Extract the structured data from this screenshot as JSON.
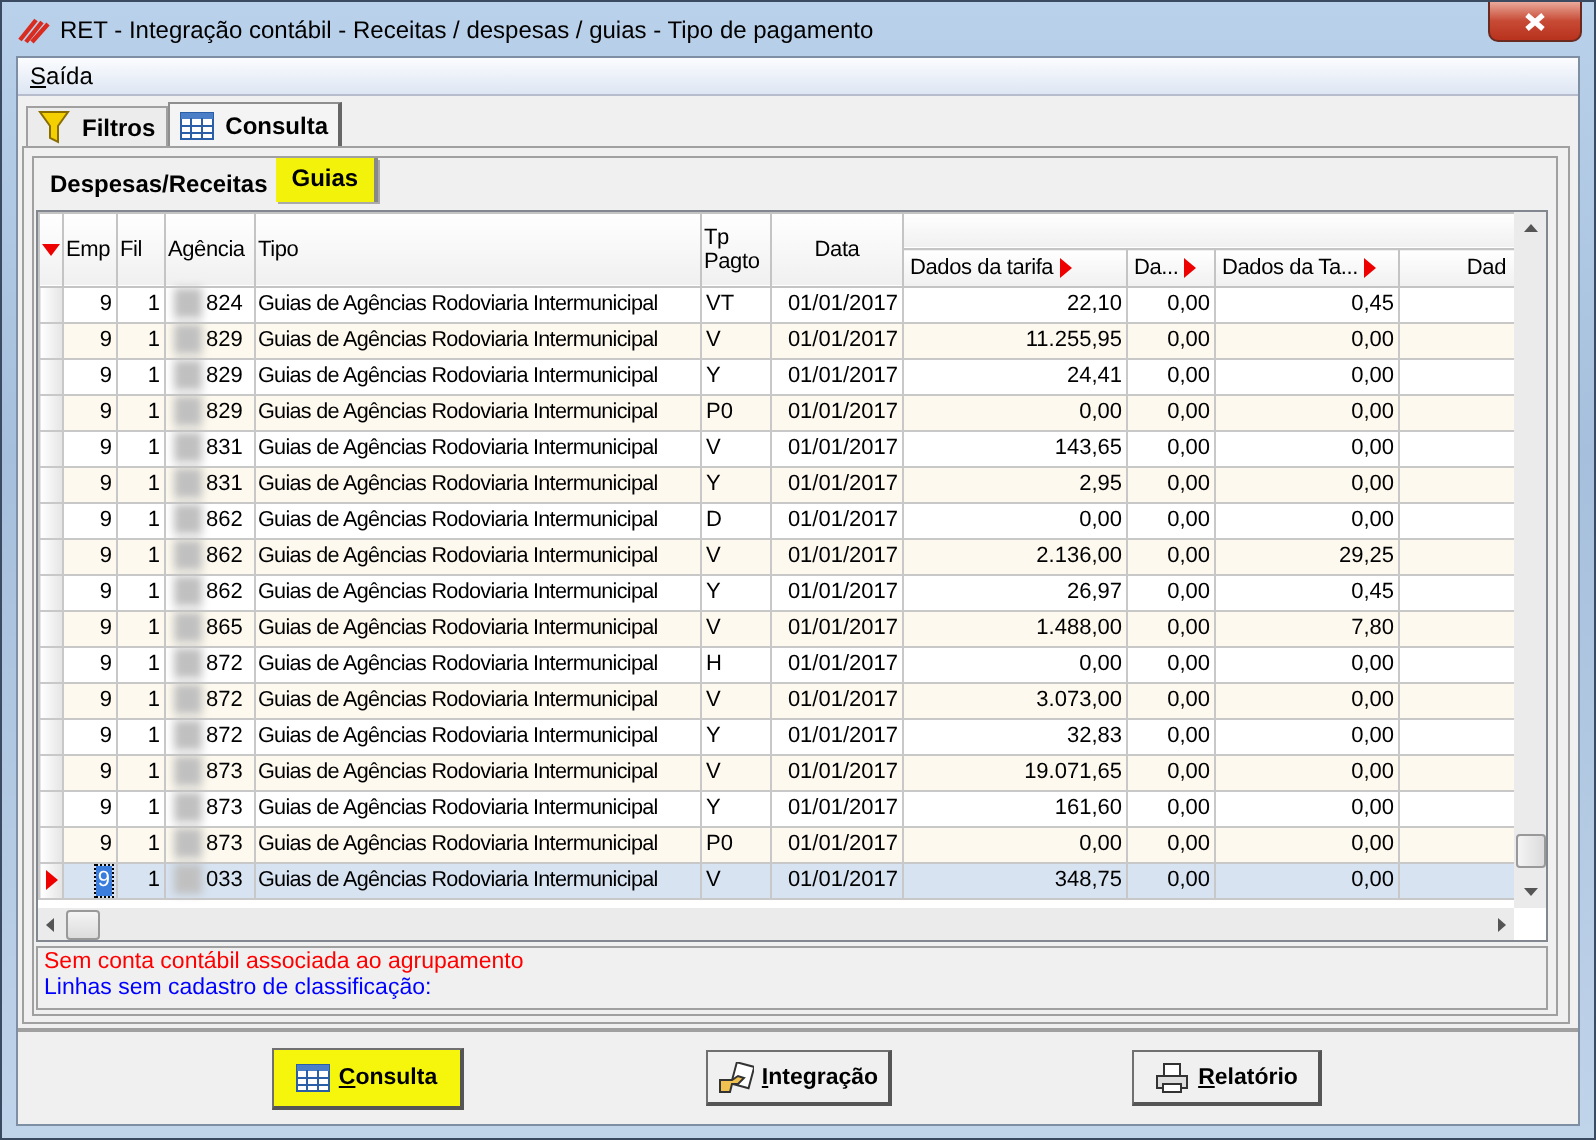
{
  "window": {
    "title": "RET -  Integração contábil - Receitas / despesas / guias - Tipo de pagamento"
  },
  "menu": [
    {
      "label": "Saída"
    }
  ],
  "tabs": [
    {
      "label": "Filtros",
      "kind": "filter",
      "selected": false
    },
    {
      "label": "Consulta",
      "kind": "table",
      "selected": true
    }
  ],
  "subtabs": [
    {
      "label": "Despesas/Receitas",
      "selected": false
    },
    {
      "label": "Guias",
      "selected": true
    }
  ],
  "table": {
    "columns": [
      {
        "label": "Emp",
        "kind": "plain"
      },
      {
        "label": "Fil",
        "kind": "plain"
      },
      {
        "label": "Agência",
        "kind": "plain"
      },
      {
        "label": "Tipo",
        "kind": "plain"
      },
      {
        "label": "Tp Pagto",
        "kind": "plain"
      },
      {
        "label": "Data",
        "kind": "plain"
      },
      {
        "label": "Dados da tarifa",
        "kind": "marked"
      },
      {
        "label": "Da...",
        "kind": "marked"
      },
      {
        "label": "Dados da Ta...",
        "kind": "marked"
      },
      {
        "label": "Dad",
        "kind": "plain"
      }
    ],
    "rows": [
      {
        "cells": [
          "9",
          "1",
          "824",
          "Guias de Agências Rodoviaria Intermunicipal",
          "VT",
          "01/01/2017",
          "22,10",
          "0,00",
          "0,45"
        ],
        "selected": false
      },
      {
        "cells": [
          "9",
          "1",
          "829",
          "Guias de Agências Rodoviaria Intermunicipal",
          "V",
          "01/01/2017",
          "11.255,95",
          "0,00",
          "0,00"
        ],
        "selected": false
      },
      {
        "cells": [
          "9",
          "1",
          "829",
          "Guias de Agências Rodoviaria Intermunicipal",
          "Y",
          "01/01/2017",
          "24,41",
          "0,00",
          "0,00"
        ],
        "selected": false
      },
      {
        "cells": [
          "9",
          "1",
          "829",
          "Guias de Agências Rodoviaria Intermunicipal",
          "P0",
          "01/01/2017",
          "0,00",
          "0,00",
          "0,00"
        ],
        "selected": false
      },
      {
        "cells": [
          "9",
          "1",
          "831",
          "Guias de Agências Rodoviaria Intermunicipal",
          "V",
          "01/01/2017",
          "143,65",
          "0,00",
          "0,00"
        ],
        "selected": false
      },
      {
        "cells": [
          "9",
          "1",
          "831",
          "Guias de Agências Rodoviaria Intermunicipal",
          "Y",
          "01/01/2017",
          "2,95",
          "0,00",
          "0,00"
        ],
        "selected": false
      },
      {
        "cells": [
          "9",
          "1",
          "862",
          "Guias de Agências Rodoviaria Intermunicipal",
          "D",
          "01/01/2017",
          "0,00",
          "0,00",
          "0,00"
        ],
        "selected": false
      },
      {
        "cells": [
          "9",
          "1",
          "862",
          "Guias de Agências Rodoviaria Intermunicipal",
          "V",
          "01/01/2017",
          "2.136,00",
          "0,00",
          "29,25"
        ],
        "selected": false
      },
      {
        "cells": [
          "9",
          "1",
          "862",
          "Guias de Agências Rodoviaria Intermunicipal",
          "Y",
          "01/01/2017",
          "26,97",
          "0,00",
          "0,45"
        ],
        "selected": false
      },
      {
        "cells": [
          "9",
          "1",
          "865",
          "Guias de Agências Rodoviaria Intermunicipal",
          "V",
          "01/01/2017",
          "1.488,00",
          "0,00",
          "7,80"
        ],
        "selected": false
      },
      {
        "cells": [
          "9",
          "1",
          "872",
          "Guias de Agências Rodoviaria Intermunicipal",
          "H",
          "01/01/2017",
          "0,00",
          "0,00",
          "0,00"
        ],
        "selected": false
      },
      {
        "cells": [
          "9",
          "1",
          "872",
          "Guias de Agências Rodoviaria Intermunicipal",
          "V",
          "01/01/2017",
          "3.073,00",
          "0,00",
          "0,00"
        ],
        "selected": false
      },
      {
        "cells": [
          "9",
          "1",
          "872",
          "Guias de Agências Rodoviaria Intermunicipal",
          "Y",
          "01/01/2017",
          "32,83",
          "0,00",
          "0,00"
        ],
        "selected": false
      },
      {
        "cells": [
          "9",
          "1",
          "873",
          "Guias de Agências Rodoviaria Intermunicipal",
          "V",
          "01/01/2017",
          "19.071,65",
          "0,00",
          "0,00"
        ],
        "selected": false
      },
      {
        "cells": [
          "9",
          "1",
          "873",
          "Guias de Agências Rodoviaria Intermunicipal",
          "Y",
          "01/01/2017",
          "161,60",
          "0,00",
          "0,00"
        ],
        "selected": false
      },
      {
        "cells": [
          "9",
          "1",
          "873",
          "Guias de Agências Rodoviaria Intermunicipal",
          "P0",
          "01/01/2017",
          "0,00",
          "0,00",
          "0,00"
        ],
        "selected": false
      },
      {
        "cells": [
          "9",
          "1",
          "033",
          "Guias de Agências Rodoviaria Intermunicipal",
          "V",
          "01/01/2017",
          "348,75",
          "0,00",
          "0,00"
        ],
        "selected": true
      }
    ]
  },
  "messages": [
    {
      "text": "Sem conta contábil associada ao agrupamento",
      "color": "#ff0000"
    },
    {
      "text": "Linhas sem cadastro de classificação:",
      "color": "#0000ff"
    }
  ],
  "buttons": [
    {
      "label": "Consulta",
      "kind": "table",
      "highlighted": true
    },
    {
      "label": "Integração",
      "kind": "hand",
      "highlighted": false
    },
    {
      "label": "Relatório",
      "kind": "printer",
      "highlighted": false
    }
  ]
}
